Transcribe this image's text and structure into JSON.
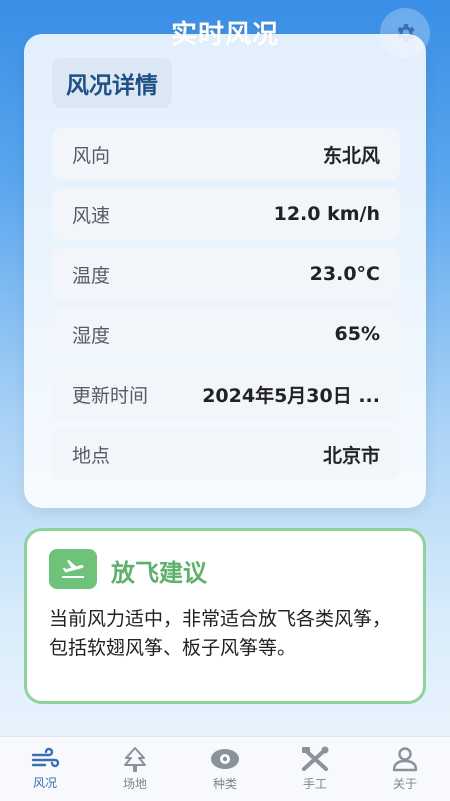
{
  "header": {
    "title": "实时风况"
  },
  "details": {
    "section_title": "风况详情",
    "rows": [
      {
        "label": "风向",
        "value": "东北风"
      },
      {
        "label": "风速",
        "value": "12.0 km/h"
      },
      {
        "label": "温度",
        "value": "23.0°C"
      },
      {
        "label": "湿度",
        "value": "65%"
      },
      {
        "label": "更新时间",
        "value": "2024年5月30日 ..."
      },
      {
        "label": "地点",
        "value": "北京市"
      }
    ]
  },
  "advice": {
    "title": "放飞建议",
    "text": "当前风力适中，非常适合放飞各类风筝，包括软翅风筝、板子风筝等。"
  },
  "nav": {
    "items": [
      {
        "label": "风况",
        "icon": "wind-icon",
        "active": true
      },
      {
        "label": "场地",
        "icon": "tree-icon",
        "active": false
      },
      {
        "label": "种类",
        "icon": "eye-icon",
        "active": false
      },
      {
        "label": "手工",
        "icon": "tools-icon",
        "active": false
      },
      {
        "label": "关于",
        "icon": "person-icon",
        "active": false
      }
    ]
  },
  "colors": {
    "primary": "#3a8ee6",
    "accent_green": "#5db16a",
    "nav_active": "#3a6fb0"
  }
}
